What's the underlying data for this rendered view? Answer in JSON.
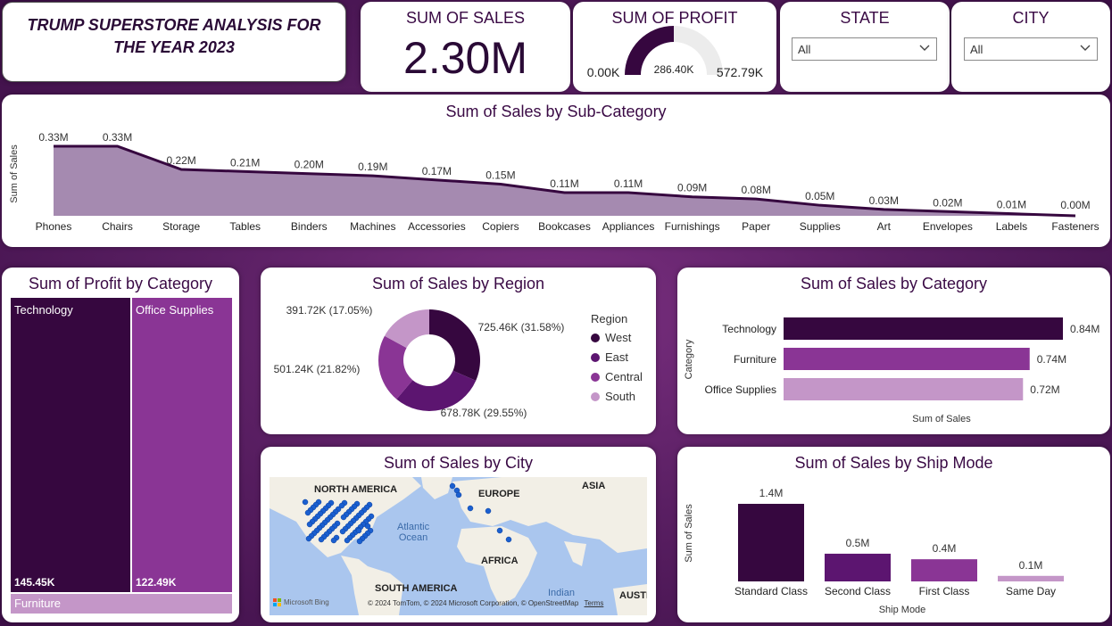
{
  "header": {
    "title": "TRUMP SUPERSTORE ANALYSIS FOR THE YEAR 2023"
  },
  "kpi_sales": {
    "title": "SUM OF SALES",
    "value": "2.30M"
  },
  "kpi_profit": {
    "title": "SUM OF PROFIT",
    "min_label": "0.00K",
    "value_label": "286.40K",
    "max_label": "572.79K",
    "value": 286.4,
    "max": 572.79
  },
  "filters": {
    "state": {
      "title": "STATE",
      "value": "All"
    },
    "city": {
      "title": "CITY",
      "value": "All"
    }
  },
  "subcategory": {
    "title": "Sum of Sales by Sub-Category",
    "ylabel": "Sum of Sales"
  },
  "profit_category": {
    "title": "Sum of Profit by Category"
  },
  "region": {
    "title": "Sum of Sales by Region",
    "legend_title": "Region"
  },
  "sales_category": {
    "title": "Sum of Sales by Category",
    "ylabel": "Category",
    "xlabel": "Sum of Sales"
  },
  "city_map": {
    "title": "Sum of Sales by City",
    "labels": {
      "north_america": "NORTH AMERICA",
      "europe": "EUROPE",
      "asia": "ASIA",
      "africa": "AFRICA",
      "south_america": "SOUTH AMERICA",
      "austr": "AUSTR",
      "atlantic": "Atlantic",
      "ocean": "Ocean",
      "indian": "Indian"
    },
    "brand": "Microsoft Bing",
    "copyright": "© 2024 TomTom, © 2024 Microsoft Corporation, © OpenStreetMap",
    "terms": "Terms"
  },
  "ship_mode": {
    "title": "Sum of Sales by Ship Mode",
    "ylabel": "Sum of Sales",
    "xlabel": "Ship Mode"
  },
  "colors": {
    "dark": "#36073f",
    "mid": "#5c1570",
    "purple": "#8a3595",
    "light": "#c496c8",
    "area_fill": "#a58ab0",
    "gauge_bg": "#ececec"
  },
  "icons": {
    "dropdown": "chevron-down-icon"
  },
  "chart_data": [
    {
      "id": "subcategory",
      "type": "area",
      "title": "Sum of Sales by Sub-Category",
      "ylabel": "Sum of Sales",
      "categories": [
        "Phones",
        "Chairs",
        "Storage",
        "Tables",
        "Binders",
        "Machines",
        "Accessories",
        "Copiers",
        "Bookcases",
        "Appliances",
        "Furnishings",
        "Paper",
        "Supplies",
        "Art",
        "Envelopes",
        "Labels",
        "Fasteners"
      ],
      "values": [
        0.33,
        0.33,
        0.22,
        0.21,
        0.2,
        0.19,
        0.17,
        0.15,
        0.11,
        0.11,
        0.09,
        0.08,
        0.05,
        0.03,
        0.02,
        0.01,
        0.0
      ],
      "labels": [
        "0.33M",
        "0.33M",
        "0.22M",
        "0.21M",
        "0.20M",
        "0.19M",
        "0.17M",
        "0.15M",
        "0.11M",
        "0.11M",
        "0.09M",
        "0.08M",
        "0.05M",
        "0.03M",
        "0.02M",
        "0.01M",
        "0.00M"
      ]
    },
    {
      "id": "profit_category",
      "type": "treemap",
      "title": "Sum of Profit by Category",
      "categories": [
        "Technology",
        "Office Supplies",
        "Furniture"
      ],
      "values": [
        145.45,
        122.49,
        18.45
      ],
      "labels": [
        "145.45K",
        "122.49K",
        ""
      ]
    },
    {
      "id": "region",
      "type": "pie",
      "title": "Sum of Sales by Region",
      "categories": [
        "West",
        "East",
        "Central",
        "South"
      ],
      "values": [
        725.46,
        678.78,
        501.24,
        391.72
      ],
      "labels": [
        "725.46K (31.58%)",
        "678.78K (29.55%)",
        "501.24K (21.82%)",
        "391.72K (17.05%)"
      ]
    },
    {
      "id": "sales_category",
      "type": "bar",
      "title": "Sum of Sales by Category",
      "categories": [
        "Technology",
        "Furniture",
        "Office Supplies"
      ],
      "values": [
        0.84,
        0.74,
        0.72
      ],
      "labels": [
        "0.84M",
        "0.74M",
        "0.72M"
      ],
      "xlabel": "Sum of Sales",
      "ylabel": "Category"
    },
    {
      "id": "ship_mode",
      "type": "bar",
      "title": "Sum of Sales by Ship Mode",
      "categories": [
        "Standard Class",
        "Second Class",
        "First Class",
        "Same Day"
      ],
      "values": [
        1.4,
        0.5,
        0.4,
        0.1
      ],
      "labels": [
        "1.4M",
        "0.5M",
        "0.4M",
        "0.1M"
      ],
      "xlabel": "Ship Mode",
      "ylabel": "Sum of Sales"
    }
  ]
}
